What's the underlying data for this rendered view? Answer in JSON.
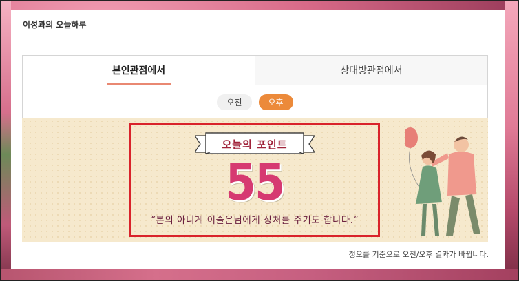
{
  "panel": {
    "title": "이성과의 오늘하루"
  },
  "tabs": [
    {
      "label": "본인관점에서",
      "active": true
    },
    {
      "label": "상대방관점에서",
      "active": false
    }
  ],
  "time_toggle": {
    "am": "오전",
    "pm": "오후",
    "selected": "오후"
  },
  "fortune": {
    "banner": "오늘의 포인트",
    "score": "55",
    "message": "“본의 아니게 이슬은님에게 상처를 주기도 합니다.”"
  },
  "footnote": "정오를 기준으로 오전/오후 결과가 바뀝니다.",
  "colors": {
    "tab_underline": "#e98872",
    "pm_pill": "#ec8a3a",
    "score": "#d63a71",
    "highlight_border": "#d9232b"
  }
}
